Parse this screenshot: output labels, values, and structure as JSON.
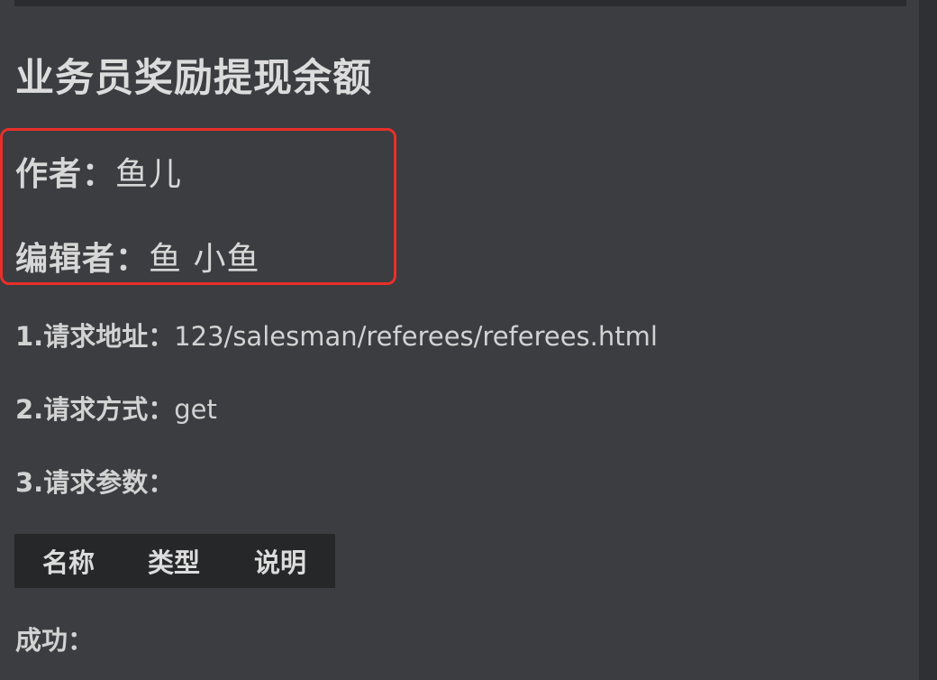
{
  "document": {
    "title": "业务员奖励提现余额",
    "author": {
      "label": "作者：",
      "value": "鱼儿"
    },
    "editor": {
      "label": "编辑者：",
      "value": "鱼 小鱼"
    },
    "request_url": {
      "label": "1.请求地址：",
      "value": "123/salesman/referees/referees.html"
    },
    "request_method": {
      "label": "2.请求方式：",
      "value": "get"
    },
    "request_params": {
      "label": "3.请求参数："
    },
    "params_table": {
      "headers": [
        "名称",
        "类型",
        "说明"
      ]
    },
    "success": {
      "label": "成功："
    }
  },
  "colors": {
    "background": "#3b3d40",
    "text": "#d7d7d7",
    "highlight_border": "#e8302a",
    "table_header_bg": "#262728"
  }
}
